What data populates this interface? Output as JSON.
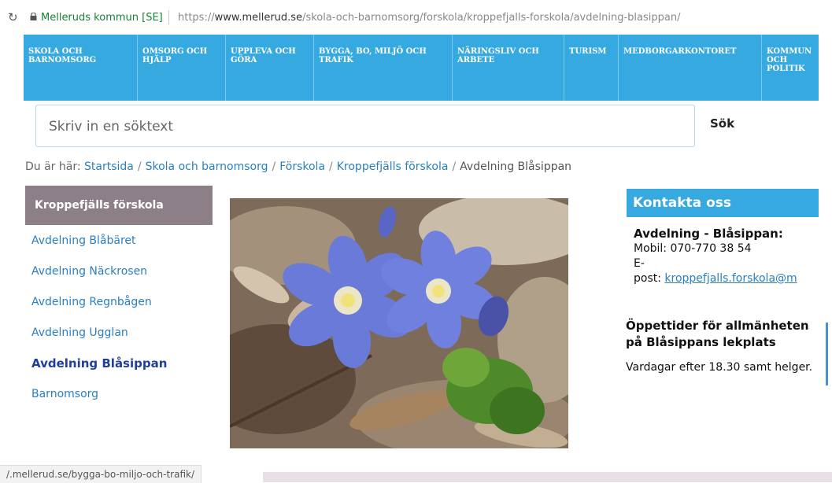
{
  "browser": {
    "site_name": "Melleruds kommun [SE]",
    "url_prefix": "https://",
    "url_domain": "www.mellerud.se",
    "url_path": "/skola-och-barnomsorg/forskola/kroppefjalls-forskola/avdelning-blasippan/",
    "status_url": "/.mellerud.se/bygga-bo-miljo-och-trafik/"
  },
  "nav": {
    "items": [
      {
        "label": "SKOLA OCH BARNOMSORG"
      },
      {
        "label": "OMSORG OCH HJÄLP"
      },
      {
        "label": "UPPLEVA OCH GÖRA"
      },
      {
        "label": "BYGGA, BO, MILJÖ OCH TRAFIK"
      },
      {
        "label": "NÄRINGSLIV OCH ARBETE"
      },
      {
        "label": "TURISM"
      },
      {
        "label": "MEDBORGARKONTORET"
      },
      {
        "label": "KOMMUN OCH POLITIK"
      }
    ]
  },
  "search": {
    "placeholder": "Skriv in en söktext",
    "button_label": "Sök"
  },
  "breadcrumb": {
    "prefix": "Du är här:",
    "links": [
      "Startsida",
      "Skola och barnomsorg",
      "Förskola",
      "Kroppefjälls förskola"
    ],
    "current": "Avdelning Blåsippan"
  },
  "sidebar": {
    "heading": "Kroppefjälls förskola",
    "items": [
      {
        "label": "Avdelning Blåbäret"
      },
      {
        "label": "Avdelning Näckrosen"
      },
      {
        "label": "Avdelning Regnbågen"
      },
      {
        "label": "Avdelning Ugglan"
      },
      {
        "label": "Avdelning Blåsippan"
      },
      {
        "label": "Barnomsorg"
      }
    ]
  },
  "contact": {
    "heading": "Kontakta oss",
    "name": "Avdelning - Blåsippan:",
    "phone": "Mobil: 070-770 38 54",
    "email_label_1": "E-",
    "email_label_2": "post:",
    "email": "kroppefjalls.forskola@m"
  },
  "opening": {
    "heading": "Öppettider för allmänheten på Blåsippans lekplats",
    "text": "Vardagar efter 18.30 samt helger."
  },
  "colors": {
    "nav_blue": "#36a9e1",
    "link_blue": "#2a7fc1",
    "sidebar_head": "#8c7f88"
  }
}
